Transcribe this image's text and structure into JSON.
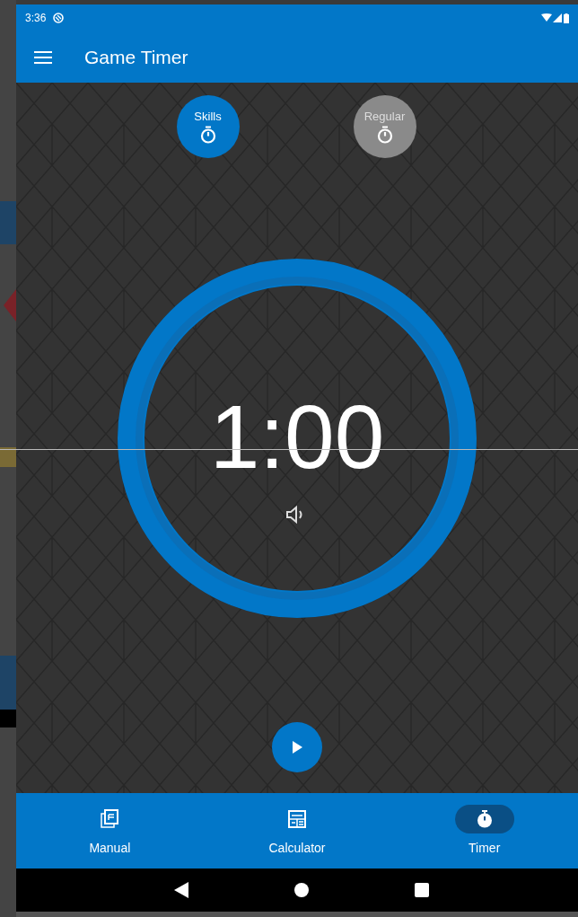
{
  "status_bar": {
    "time": "3:36"
  },
  "app_bar": {
    "title": "Game Timer"
  },
  "modes": [
    {
      "label": "Skills",
      "selected": true
    },
    {
      "label": "Regular",
      "selected": false
    }
  ],
  "timer": {
    "time": "1:00",
    "sound_on": true
  },
  "bottom_nav": [
    {
      "label": "Manual",
      "selected": false
    },
    {
      "label": "Calculator",
      "selected": false
    },
    {
      "label": "Timer",
      "selected": true
    }
  ]
}
